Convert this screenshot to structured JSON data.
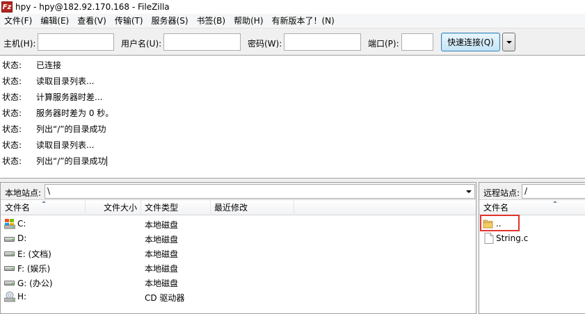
{
  "window": {
    "title": "hpy - hpy@182.92.170.168 - FileZilla",
    "icon_text": "Fz"
  },
  "menu": [
    "文件(F)",
    "编辑(E)",
    "查看(V)",
    "传输(T)",
    "服务器(S)",
    "书签(B)",
    "帮助(H)",
    "有新版本了！(N)"
  ],
  "quickconnect": {
    "host_label": "主机(H):",
    "user_label": "用户名(U):",
    "pass_label": "密码(W):",
    "port_label": "端口(P):",
    "host_value": "",
    "user_value": "",
    "pass_value": "",
    "port_value": "",
    "connect_button": "快速连接(Q)",
    "dropdown_icon": "chevron-down-icon"
  },
  "log": [
    {
      "label": "状态:",
      "message": "已连接"
    },
    {
      "label": "状态:",
      "message": "读取目录列表..."
    },
    {
      "label": "状态:",
      "message": "计算服务器时差..."
    },
    {
      "label": "状态:",
      "message": "服务器时差为 0 秒。"
    },
    {
      "label": "状态:",
      "message": "列出“/”的目录成功"
    },
    {
      "label": "状态:",
      "message": "读取目录列表..."
    },
    {
      "label": "状态:",
      "message": "列出“/”的目录成功"
    }
  ],
  "local": {
    "site_label": "本地站点:",
    "path": "\\",
    "columns": [
      "文件名",
      "文件大小",
      "文件类型",
      "最近修改"
    ],
    "files": [
      {
        "name": "C:",
        "type": "本地磁盘",
        "icon": "windows-drive-icon"
      },
      {
        "name": "D:",
        "type": "本地磁盘",
        "icon": "hard-drive-icon"
      },
      {
        "name": "E: (文档)",
        "type": "本地磁盘",
        "icon": "hard-drive-icon"
      },
      {
        "name": "F: (娱乐)",
        "type": "本地磁盘",
        "icon": "hard-drive-icon"
      },
      {
        "name": "G: (办公)",
        "type": "本地磁盘",
        "icon": "hard-drive-icon"
      },
      {
        "name": "H:",
        "type": "CD 驱动器",
        "icon": "cd-drive-icon"
      }
    ]
  },
  "remote": {
    "site_label": "远程站点:",
    "path": "/",
    "columns": [
      "文件名"
    ],
    "files": [
      {
        "name": "..",
        "icon": "folder-icon"
      },
      {
        "name": "String.c",
        "icon": "file-icon"
      }
    ]
  },
  "colors": {
    "highlight": "#e0332d",
    "accent_button": "#3c7fb1"
  }
}
